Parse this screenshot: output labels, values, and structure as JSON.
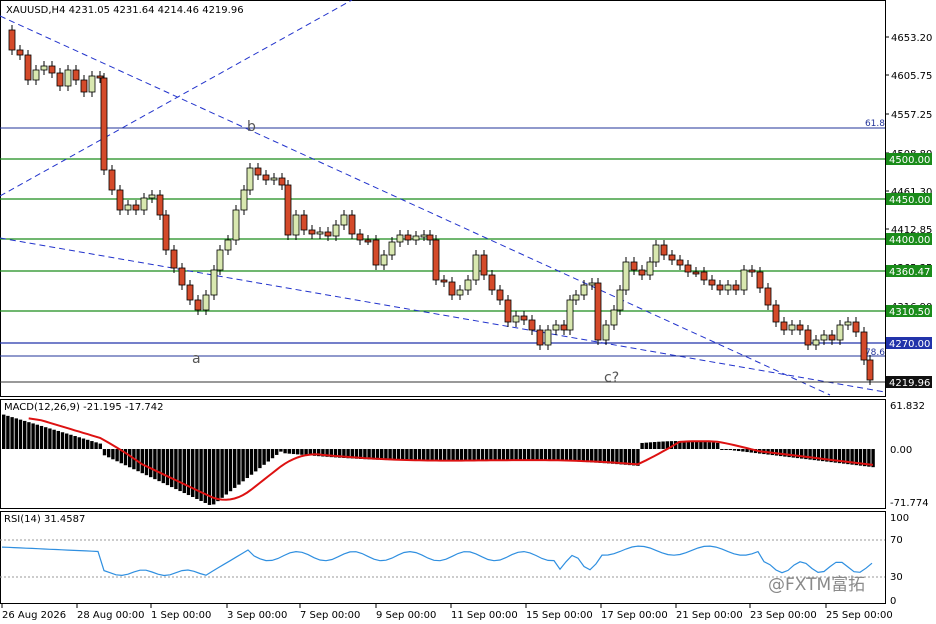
{
  "header": {
    "symbol_line": "XAUUSD,H4  4231.05 4231.64 4214.46 4219.96"
  },
  "price_axis": {
    "ticks": [
      "4653.20",
      "4605.75",
      "4557.25",
      "4508.80",
      "4461.30",
      "4412.85",
      "4365.35",
      "4316.90"
    ]
  },
  "horizontal_levels": [
    {
      "label": "4500.00",
      "color": "#1a8c1a"
    },
    {
      "label": "4450.00",
      "color": "#1a8c1a"
    },
    {
      "label": "4400.00",
      "color": "#1a8c1a"
    },
    {
      "label": "4360.47",
      "color": "#1a8c1a"
    },
    {
      "label": "4310.50",
      "color": "#1a8c1a"
    },
    {
      "label": "4270.00",
      "color": "#2233aa"
    }
  ],
  "current_price": {
    "label": "4219.96"
  },
  "fib": {
    "label_top": "61.8",
    "label_bottom": "78.6"
  },
  "wave_labels": [
    "b",
    "a",
    "c?"
  ],
  "macd": {
    "title": "MACD(12,26,9) -21.195 -17.742",
    "ticks": [
      "61.832",
      "0.00",
      "-71.774"
    ]
  },
  "rsi": {
    "title": "RSI(14) 31.4587",
    "ticks": [
      "100",
      "70",
      "30",
      "0"
    ]
  },
  "time_axis": {
    "labels": [
      "26 Aug 2026",
      "28 Aug 00:00",
      "1 Sep 00:00",
      "3 Sep 00:00",
      "7 Sep 00:00",
      "9 Sep 00:00",
      "11 Sep 00:00",
      "15 Sep 00:00",
      "17 Sep 00:00",
      "21 Sep 00:00",
      "23 Sep 00:00",
      "25 Sep 00:00"
    ]
  },
  "watermark": {
    "text": "@FXTM富拓"
  },
  "colors": {
    "bull": "#d9e8b0",
    "bear": "#d44a2a",
    "signal": "#dd1111",
    "rsi": "#2f8fe0"
  }
}
